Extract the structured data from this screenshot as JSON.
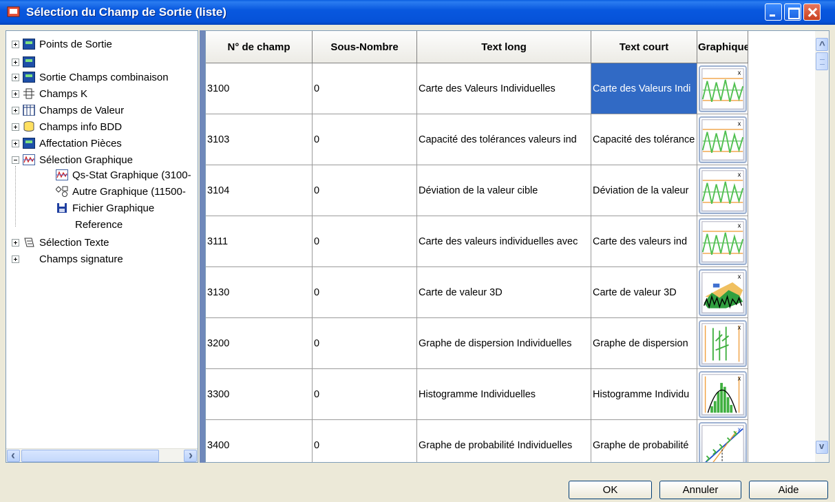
{
  "window": {
    "title": "Sélection du Champ de Sortie (liste)"
  },
  "tree": {
    "items": [
      {
        "label": "Points de Sortie",
        "icon": "calculator-icon"
      },
      {
        "label": "",
        "icon": "calculator-icon"
      },
      {
        "label": "Sortie Champs combinaison",
        "icon": "calculator-icon"
      },
      {
        "label": "Champs K",
        "icon": "k-fields-icon"
      },
      {
        "label": "Champs de Valeur",
        "icon": "value-table-icon"
      },
      {
        "label": "Champs info BDD",
        "icon": "database-icon"
      },
      {
        "label": "Affectation Pièces",
        "icon": "calculator-icon"
      },
      {
        "label": "Sélection Graphique",
        "icon": "chart-icon"
      },
      {
        "label": "Qs-Stat Graphique (3100-",
        "icon": "chart-icon"
      },
      {
        "label": "Autre Graphique (11500-",
        "icon": "shapes-icon"
      },
      {
        "label": "Fichier Graphique",
        "icon": "floppy-icon"
      },
      {
        "label": "Reference",
        "icon": ""
      },
      {
        "label": "Sélection Texte",
        "icon": "text-selection-icon"
      },
      {
        "label": "Champs signature",
        "icon": ""
      }
    ]
  },
  "grid": {
    "columns": [
      "N° de champ",
      "Sous-Nombre",
      "Text long",
      "Text court",
      "Graphique"
    ],
    "rows": [
      {
        "num": "3100",
        "sub": "0",
        "long": "Carte des Valeurs Individuelles",
        "short": "Carte des Valeurs Indi",
        "graphic": "control-chart-icon"
      },
      {
        "num": "3103",
        "sub": "0",
        "long": "Capacité des tolérances valeurs ind",
        "short": "Capacité des tolérance",
        "graphic": "control-chart-icon"
      },
      {
        "num": "3104",
        "sub": "0",
        "long": "Déviation de la valeur cible",
        "short": "Déviation de la valeur",
        "graphic": "control-chart-icon"
      },
      {
        "num": "3111",
        "sub": "0",
        "long": "Carte des valeurs individuelles avec",
        "short": "Carte des valeurs ind",
        "graphic": "control-chart-icon"
      },
      {
        "num": "3130",
        "sub": "0",
        "long": "Carte de valeur 3D",
        "short": "Carte de valeur 3D",
        "graphic": "3d-chart-icon"
      },
      {
        "num": "3200",
        "sub": "0",
        "long": "Graphe de dispersion Individuelles",
        "short": "Graphe de dispersion",
        "graphic": "dispersion-chart-icon"
      },
      {
        "num": "3300",
        "sub": "0",
        "long": "Histogramme Individuelles",
        "short": "Histogramme Individu",
        "graphic": "histogram-icon"
      },
      {
        "num": "3400",
        "sub": "0",
        "long": "Graphe de probabilité Individuelles",
        "short": "Graphe de probabilité",
        "graphic": "probability-chart-icon"
      }
    ]
  },
  "buttons": {
    "ok": "OK",
    "cancel": "Annuler",
    "help": "Aide"
  },
  "colors": {
    "titlebar": "#0858df",
    "selection": "#316ac5",
    "splitter": "#6f88ba"
  }
}
